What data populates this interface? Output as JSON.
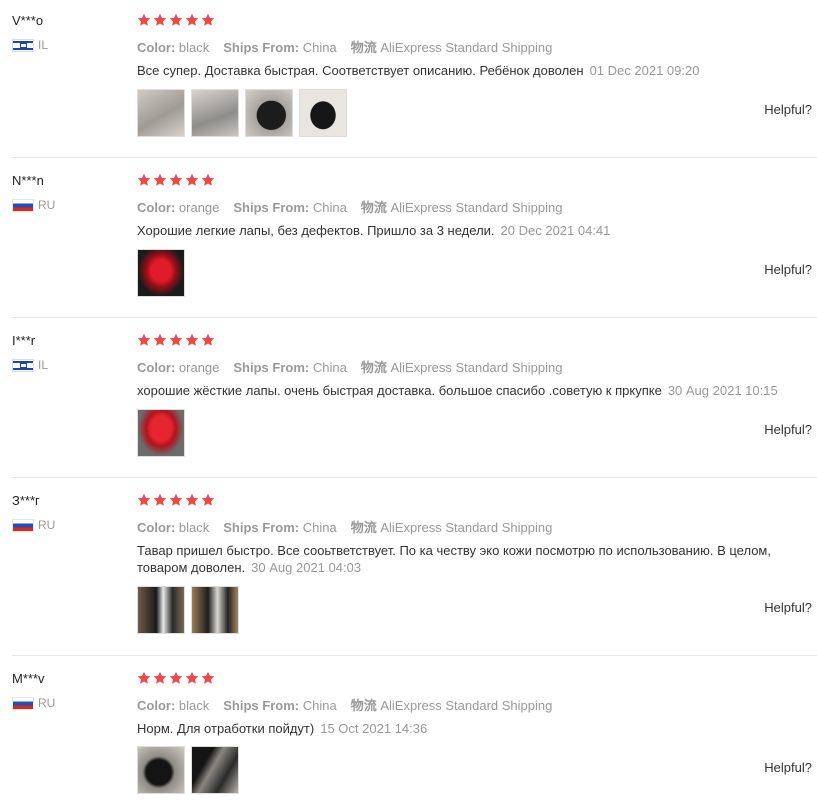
{
  "colors": {
    "star": "#f04645",
    "meta": "#999999",
    "text": "#333333"
  },
  "helpful_label": "Helpful?",
  "reviews": [
    {
      "user": "V***o",
      "country": "IL",
      "flag": "il",
      "color_label": "Color:",
      "color": "black",
      "ships_label": "Ships From:",
      "ships": "China",
      "logistics_label": "物流",
      "logistics": "AliExpress Standard Shipping",
      "text": "Все супер. Доставка быстрая. Соответствует описанию. Ребёнок доволен",
      "date": "01 Dec 2021 09:20",
      "photos": 4
    },
    {
      "user": "N***n",
      "country": "RU",
      "flag": "ru",
      "color_label": "Color:",
      "color": "orange",
      "ships_label": "Ships From:",
      "ships": "China",
      "logistics_label": "物流",
      "logistics": "AliExpress Standard Shipping",
      "text": "Хорошие легкие лапы, без дефектов. Пришло за 3 недели.",
      "date": "20 Dec 2021 04:41",
      "photos": 1
    },
    {
      "user": "I***r",
      "country": "IL",
      "flag": "il",
      "color_label": "Color:",
      "color": "orange",
      "ships_label": "Ships From:",
      "ships": "China",
      "logistics_label": "物流",
      "logistics": "AliExpress Standard Shipping",
      "text": "хорошие жёсткие лапы. очень быстрая доставка. большое спасибо .советую к пркупке",
      "date": "30 Aug 2021 10:15",
      "photos": 1
    },
    {
      "user": "З***г",
      "country": "RU",
      "flag": "ru",
      "color_label": "Color:",
      "color": "black",
      "ships_label": "Ships From:",
      "ships": "China",
      "logistics_label": "物流",
      "logistics": "AliExpress Standard Shipping",
      "text": "Тавар пришел быстро. Все сооьтветствует. По ка честву эко кожи посмотрю по использованию. В целом, товаром доволен.",
      "date": "30 Aug 2021 04:03",
      "photos": 2
    },
    {
      "user": "M***v",
      "country": "RU",
      "flag": "ru",
      "color_label": "Color:",
      "color": "black",
      "ships_label": "Ships From:",
      "ships": "China",
      "logistics_label": "物流",
      "logistics": "AliExpress Standard Shipping",
      "text": "Норм. Для отработки пойдут)",
      "date": "15 Oct 2021 14:36",
      "photos": 2
    }
  ]
}
